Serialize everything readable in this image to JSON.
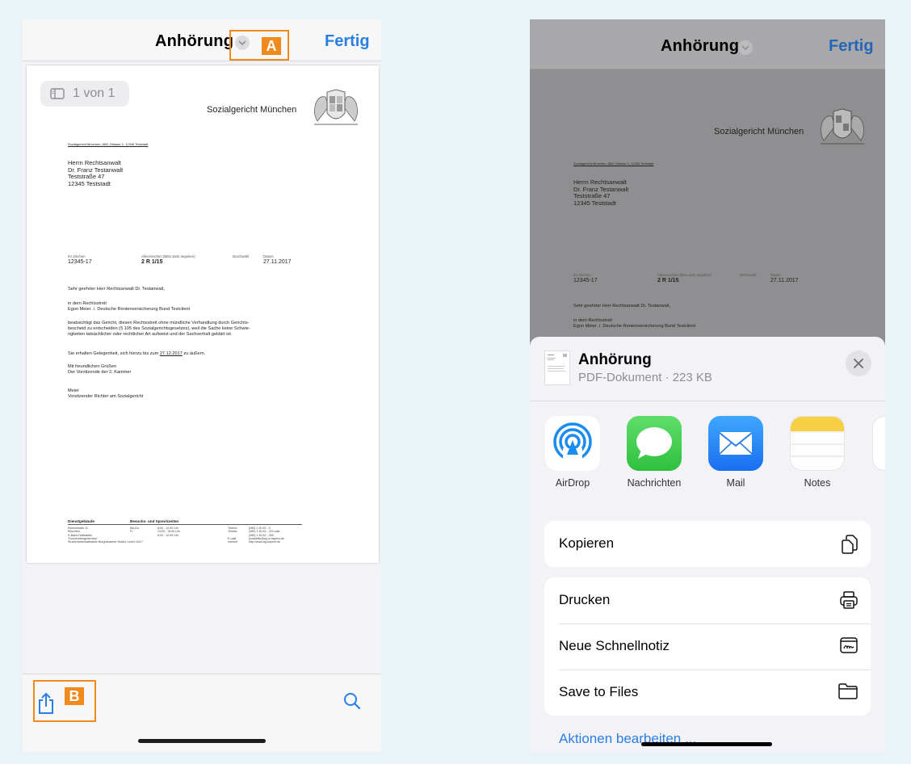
{
  "left_phone": {
    "nav": {
      "title": "Anhörung",
      "done": "Fertig",
      "callout_a": "A"
    },
    "page_counter": "1 von 1",
    "document": {
      "court": "Sozialgericht München",
      "sender_line": "Sozialgericht München, ABC-Strasse 1, 12345 Teststadt",
      "recipient": [
        "Herrn Rechtsanwalt",
        "Dr. Franz Testanwalt",
        "Teststraße 47",
        "12345 Teststadt"
      ],
      "meta_labels": {
        "ihr_zeichen": "Ihr Zeichen",
        "aktenzeichen": "Aktenzeichen (Bitte stets angeben)",
        "durchwahl": "Durchwahl",
        "datum": "Datum"
      },
      "meta_values": {
        "ihr_zeichen": "12345-17",
        "aktenzeichen": "2 R 1/15",
        "datum": "27.11.2017"
      },
      "salutation": "Sehr geehrter Herr Rechtsanwalt Dr. Testanwalt,",
      "rechtsstreit": [
        "in dem Rechtsstreit",
        "Egon Meier ./. Deutsche Rentenversicherung Bund Testclient"
      ],
      "body": [
        "beabsichtigt das Gericht, diesen Rechtsstreit ohne mündliche Verhandlung durch Gerichts-",
        "bescheid zu entscheiden (§ 105 des Sozialgerichtsgesetzes), weil die Sache keine Schwie-",
        "rigkeiten tatsächlicher oder rechtlicher Art aufweist und der Sachverhalt geklärt ist."
      ],
      "gelegenheit_pre": "Sie erhalten Gelegenheit, sich hierzu bis zum ",
      "gelegenheit_date": "27.12.2017",
      "gelegenheit_post": " zu äußern.",
      "closing": [
        "Mit freundlichen Grüßen",
        "Der Vorsitzende der 2. Kammer"
      ],
      "signature": [
        "Meier",
        "Vorsitzender Richter am Sozialgericht"
      ],
      "footer": {
        "h1": "Dienstgebäude",
        "h2": "Besuchs- und Sprechzeiten",
        "col1": [
          "Richelstraße 11",
          "München",
          "S-Bahn-Haltestelle",
          "\"Donnersbergerbrücke\"",
          "Straßenbahnhaltestelle Burghausener Straße Linien 16/17"
        ],
        "col2": [
          "Mo-Do",
          "",
          "Fr"
        ],
        "col3": [
          "8:00 - 12:00 Uhr",
          "13:00 - 15:00 Uhr",
          "8:00 - 12:00 Uhr"
        ],
        "col4": [
          "Telefon",
          "Telefax",
          "",
          "E-mail",
          "Internet"
        ],
        "col5": [
          "(089) 1 30 62 - 0",
          "(089) 1 30 62 - 223 oder",
          "(089) 1 30 62 - 259",
          "poststelle@sg-m.bayern.de",
          "http://www.lsg.bayern.de"
        ]
      }
    },
    "toolbar": {
      "callout_b": "B"
    }
  },
  "right_phone": {
    "nav": {
      "title": "Anhörung",
      "done": "Fertig"
    },
    "sheet": {
      "title": "Anhörung",
      "subtitle": "PDF-Dokument · 223 KB",
      "apps": [
        {
          "name": "AirDrop",
          "icon": "airdrop-icon"
        },
        {
          "name": "Nachrichten",
          "icon": "messages-icon"
        },
        {
          "name": "Mail",
          "icon": "mail-icon"
        },
        {
          "name": "Notes",
          "icon": "notes-icon"
        }
      ],
      "actions": [
        {
          "label": "Kopieren",
          "icon": "copy-icon"
        },
        {
          "label": "Drucken",
          "icon": "print-icon"
        },
        {
          "label": "Neue Schnellnotiz",
          "icon": "quick-note-icon"
        },
        {
          "label": "Save to Files",
          "icon": "folder-icon"
        }
      ],
      "edit_actions": "Aktionen bearbeiten ..."
    }
  },
  "colors": {
    "accent": "#2a7fe6",
    "callout": "#f08a1c"
  }
}
